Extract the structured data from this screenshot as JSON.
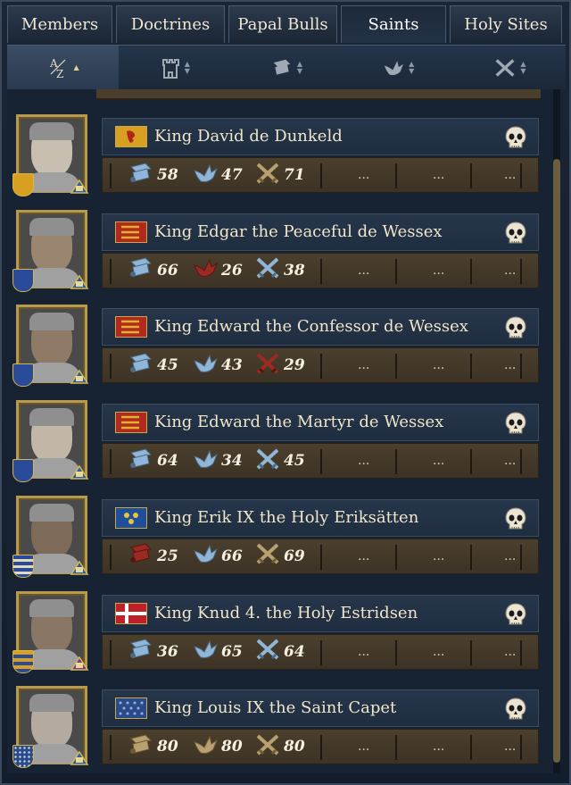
{
  "tabs": [
    {
      "label": "Members",
      "active": false
    },
    {
      "label": "Doctrines",
      "active": false
    },
    {
      "label": "Papal Bulls",
      "active": false
    },
    {
      "label": "Saints",
      "active": true
    },
    {
      "label": "Holy Sites",
      "active": false
    }
  ],
  "sort_buttons": [
    {
      "icon": "alphabetical-sort-icon",
      "active": true,
      "direction": "ascending"
    },
    {
      "icon": "tower-icon",
      "active": false
    },
    {
      "icon": "scroll-icon",
      "active": false
    },
    {
      "icon": "dove-icon",
      "active": false
    },
    {
      "icon": "crossed-swords-icon",
      "active": false
    }
  ],
  "colors": {
    "positive_scroll": "#8fb6d6",
    "negative_red": "#9a2a22",
    "gold_neutral": "#b8a070",
    "accent_gold": "#b89a4e"
  },
  "saints": [
    {
      "name": "King David de Dunkeld",
      "flag": "scotland",
      "coa": "scotland",
      "stats": [
        {
          "icon": "scroll-icon",
          "value": "58",
          "tone": "blue"
        },
        {
          "icon": "dove-icon",
          "value": "47",
          "tone": "blue"
        },
        {
          "icon": "crossed-swords-icon",
          "value": "71",
          "tone": "gold"
        }
      ],
      "extra": [
        "...",
        "...",
        "..."
      ]
    },
    {
      "name": "King Edgar the Peaceful de Wessex",
      "flag": "england",
      "coa": "wessex-cross",
      "stats": [
        {
          "icon": "scroll-icon",
          "value": "66",
          "tone": "blue"
        },
        {
          "icon": "dove-icon",
          "value": "26",
          "tone": "red"
        },
        {
          "icon": "crossed-swords-icon",
          "value": "38",
          "tone": "blue"
        }
      ],
      "extra": [
        "...",
        "...",
        "..."
      ]
    },
    {
      "name": "King Edward the Confessor de Wessex",
      "flag": "england",
      "coa": "wessex-cross",
      "stats": [
        {
          "icon": "scroll-icon",
          "value": "45",
          "tone": "blue"
        },
        {
          "icon": "dove-icon",
          "value": "43",
          "tone": "blue"
        },
        {
          "icon": "crossed-swords-icon",
          "value": "29",
          "tone": "red"
        }
      ],
      "extra": [
        "...",
        "...",
        "..."
      ]
    },
    {
      "name": "King Edward the Martyr de Wessex",
      "flag": "england",
      "coa": "wessex-cross",
      "stats": [
        {
          "icon": "scroll-icon",
          "value": "64",
          "tone": "blue"
        },
        {
          "icon": "dove-icon",
          "value": "34",
          "tone": "blue"
        },
        {
          "icon": "crossed-swords-icon",
          "value": "45",
          "tone": "blue"
        }
      ],
      "extra": [
        "...",
        "...",
        "..."
      ]
    },
    {
      "name": "King Erik IX the Holy Eriksätten",
      "flag": "sweden",
      "coa": "eriksatten",
      "stats": [
        {
          "icon": "scroll-icon",
          "value": "25",
          "tone": "red"
        },
        {
          "icon": "dove-icon",
          "value": "66",
          "tone": "blue"
        },
        {
          "icon": "crossed-swords-icon",
          "value": "69",
          "tone": "gold"
        }
      ],
      "extra": [
        "...",
        "...",
        "..."
      ]
    },
    {
      "name": "King Knud 4. the Holy Estridsen",
      "flag": "denmark",
      "coa": "estridsen",
      "stats": [
        {
          "icon": "scroll-icon",
          "value": "36",
          "tone": "blue"
        },
        {
          "icon": "dove-icon",
          "value": "65",
          "tone": "blue"
        },
        {
          "icon": "crossed-swords-icon",
          "value": "64",
          "tone": "blue"
        }
      ],
      "extra": [
        "...",
        "...",
        "..."
      ]
    },
    {
      "name": "King Louis IX the Saint Capet",
      "flag": "france",
      "coa": "capet",
      "stats": [
        {
          "icon": "scroll-icon",
          "value": "80",
          "tone": "gold"
        },
        {
          "icon": "dove-icon",
          "value": "80",
          "tone": "gold"
        },
        {
          "icon": "crossed-swords-icon",
          "value": "80",
          "tone": "gold"
        }
      ],
      "extra": [
        "...",
        "...",
        "..."
      ]
    }
  ]
}
